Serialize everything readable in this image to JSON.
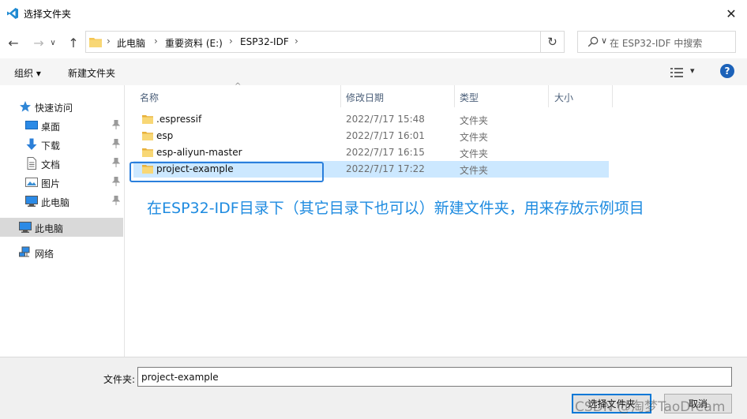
{
  "window": {
    "title": "选择文件夹",
    "close_glyph": "✕"
  },
  "nav": {
    "back_glyph": "←",
    "forward_glyph": "→",
    "recent_glyph": "∨",
    "up_glyph": "↑",
    "breadcrumbs": [
      "此电脑",
      "重要资料 (E:)",
      "ESP32-IDF"
    ],
    "crumb_sep": "›",
    "dropdown_glyph": "∨",
    "refresh_glyph": "↻",
    "search_placeholder": "在 ESP32-IDF 中搜索"
  },
  "toolbar": {
    "organize": "组织 ▾",
    "new_folder": "新建文件夹",
    "view_caret": "▾",
    "help": "?"
  },
  "sidebar": {
    "items": [
      {
        "label": "快速访问",
        "icon": "star-icon",
        "pinned": false
      },
      {
        "label": "桌面",
        "icon": "desktop-icon",
        "pinned": true
      },
      {
        "label": "下载",
        "icon": "download-icon",
        "pinned": true
      },
      {
        "label": "文档",
        "icon": "document-icon",
        "pinned": true
      },
      {
        "label": "图片",
        "icon": "picture-icon",
        "pinned": true
      },
      {
        "label": "此电脑",
        "icon": "computer-icon",
        "pinned": true
      },
      {
        "label": "此电脑",
        "icon": "computer-icon",
        "pinned": false,
        "selected": true
      },
      {
        "label": "网络",
        "icon": "network-icon",
        "pinned": false
      }
    ],
    "pin_glyph": "📌"
  },
  "columns": {
    "name": "名称",
    "date": "修改日期",
    "type": "类型",
    "size": "大小",
    "sort_glyph": "^"
  },
  "files": [
    {
      "name": ".espressif",
      "date": "2022/7/17 15:48",
      "type": "文件夹"
    },
    {
      "name": "esp",
      "date": "2022/7/17 16:01",
      "type": "文件夹"
    },
    {
      "name": "esp-aliyun-master",
      "date": "2022/7/17 16:15",
      "type": "文件夹"
    },
    {
      "name": "project-example",
      "date": "2022/7/17 17:22",
      "type": "文件夹",
      "selected": true
    }
  ],
  "annotation": "在ESP32-IDF目录下（其它目录下也可以）新建文件夹，用来存放示例项目",
  "footer": {
    "folder_label": "文件夹:",
    "folder_value": "project-example",
    "select_button": "选择文件夹",
    "cancel_button": "取消",
    "watermark": "CSDN @淘梦TaoDream"
  },
  "colors": {
    "accent": "#0078d7",
    "selection": "#cce8ff",
    "annotation": "#1e8be0",
    "folder": "#f5c652"
  }
}
